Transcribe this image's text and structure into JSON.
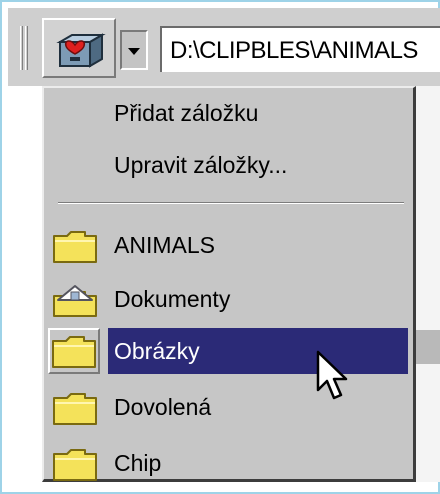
{
  "address_bar": {
    "value": "D:\\CLIPBLES\\ANIMALS"
  },
  "colors": {
    "menu_bg": "#c6c6c6",
    "selection_bg": "#2b2a77",
    "selection_text": "#ffffff",
    "folder_yellow": "#f4e25a"
  },
  "toolbar": {
    "favorites_icon": "favorites-folder-icon",
    "dropdown_icon": "chevron-down-icon"
  },
  "menu": {
    "commands": [
      {
        "label": "Přidat záložku"
      },
      {
        "label": "Upravit záložky..."
      }
    ],
    "favorites": [
      {
        "label": "ANIMALS",
        "icon": "folder-icon"
      },
      {
        "label": "Dokumenty",
        "icon": "documents-folder-icon"
      },
      {
        "label": "Obrázky",
        "icon": "folder-icon",
        "selected": true
      },
      {
        "label": "Dovolená",
        "icon": "folder-icon"
      },
      {
        "label": "Chip",
        "icon": "folder-icon"
      }
    ]
  }
}
